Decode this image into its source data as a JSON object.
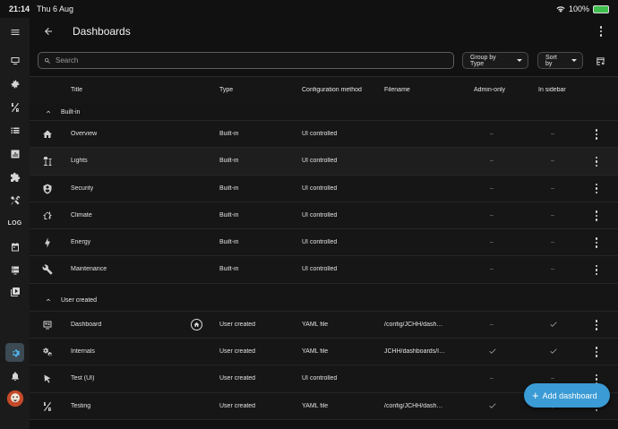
{
  "status_bar": {
    "time": "21:14",
    "date": "Thu 6 Aug",
    "battery": "100%"
  },
  "header": {
    "title": "Dashboards"
  },
  "search": {
    "placeholder": "Search"
  },
  "filters": {
    "group_by": "Group by Type",
    "sort_by": "Sort by"
  },
  "columns": {
    "title": "Title",
    "type": "Type",
    "config": "Configuration method",
    "filename": "Filename",
    "admin": "Admin-only",
    "sidebar": "In sidebar"
  },
  "groups": {
    "builtin": "Built-in",
    "user": "User created"
  },
  "rows_builtin": [
    {
      "icon": "home-icon",
      "title": "Overview",
      "type": "Built-in",
      "config": "UI controlled",
      "filename": "",
      "admin": "–",
      "sidebar": "–"
    },
    {
      "icon": "floor-lamp-icon",
      "title": "Lights",
      "type": "Built-in",
      "config": "UI controlled",
      "filename": "",
      "admin": "–",
      "sidebar": "–"
    },
    {
      "icon": "shield-icon",
      "title": "Security",
      "type": "Built-in",
      "config": "UI controlled",
      "filename": "",
      "admin": "–",
      "sidebar": "–"
    },
    {
      "icon": "home-thermometer-icon",
      "title": "Climate",
      "type": "Built-in",
      "config": "UI controlled",
      "filename": "",
      "admin": "–",
      "sidebar": "–"
    },
    {
      "icon": "lightning-bolt-icon",
      "title": "Energy",
      "type": "Built-in",
      "config": "UI controlled",
      "filename": "",
      "admin": "–",
      "sidebar": "–"
    },
    {
      "icon": "wrench-icon",
      "title": "Maintenance",
      "type": "Built-in",
      "config": "UI controlled",
      "filename": "",
      "admin": "–",
      "sidebar": "–"
    }
  ],
  "rows_user": [
    {
      "icon": "monitor-dashboard-icon",
      "title": "Dashboard",
      "type": "User created",
      "config": "YAML file",
      "filename": "/config/JCHH/dash…",
      "admin": "–",
      "sidebar": "check"
    },
    {
      "icon": "cogs-icon",
      "title": "Internals",
      "type": "User created",
      "config": "YAML file",
      "filename": "JCHH/dashboards/I…",
      "admin": "check",
      "sidebar": "check"
    },
    {
      "icon": "cursor-icon",
      "title": "Test (UI)",
      "type": "User created",
      "config": "UI controlled",
      "filename": "",
      "admin": "–",
      "sidebar": "–"
    },
    {
      "icon": "ab-testing-icon",
      "title": "Testing",
      "type": "User created",
      "config": "YAML file",
      "filename": "/config/JCHH/dash…",
      "admin": "check",
      "sidebar": "check"
    }
  ],
  "fab": {
    "label": "Add dashboard"
  },
  "sidebar_rail": [
    {
      "name": "overview-icon"
    },
    {
      "name": "automations-icon"
    },
    {
      "name": "ab-testing-icon"
    },
    {
      "name": "list-icon"
    },
    {
      "name": "chart-icon"
    },
    {
      "name": "puzzle-icon"
    },
    {
      "name": "tools-icon"
    },
    {
      "name": "log-icon",
      "label": "LOG"
    },
    {
      "name": "calendar-icon"
    },
    {
      "name": "server-icon"
    },
    {
      "name": "media-icon"
    },
    {
      "name": "settings-icon"
    },
    {
      "name": "notifications-icon"
    },
    {
      "name": "user-avatar"
    }
  ]
}
